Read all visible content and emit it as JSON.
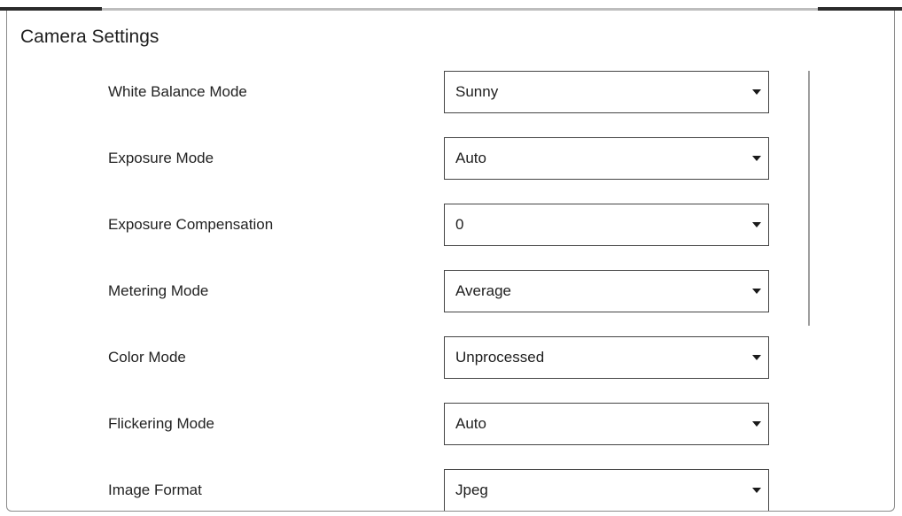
{
  "title": "Camera Settings",
  "settings": [
    {
      "label": "White Balance Mode",
      "value": "Sunny"
    },
    {
      "label": "Exposure Mode",
      "value": "Auto"
    },
    {
      "label": "Exposure Compensation",
      "value": "0"
    },
    {
      "label": "Metering Mode",
      "value": "Average"
    },
    {
      "label": "Color Mode",
      "value": "Unprocessed"
    },
    {
      "label": "Flickering Mode",
      "value": "Auto"
    },
    {
      "label": "Image Format",
      "value": "Jpeg"
    }
  ],
  "icons": {
    "dropdown": "chevron-down-icon"
  }
}
